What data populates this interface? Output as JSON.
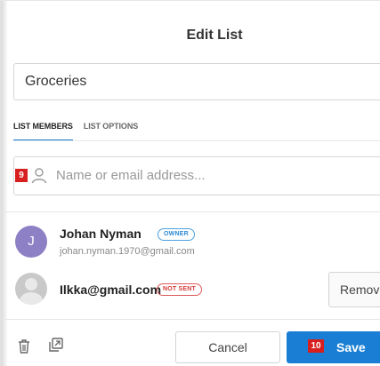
{
  "dialog": {
    "title": "Edit List",
    "list_name_value": "Groceries"
  },
  "tabs": [
    {
      "label": "LIST MEMBERS",
      "active": true
    },
    {
      "label": "LIST OPTIONS",
      "active": false
    }
  ],
  "member_input": {
    "badge": "9",
    "placeholder": "Name or email address..."
  },
  "members": [
    {
      "avatar_letter": "J",
      "name": "Johan Nyman",
      "badge": "OWNER",
      "email": "johan.nyman.1970@gmail.com"
    },
    {
      "avatar_letter": "",
      "name": "Ilkka@gmail.com",
      "badge": "NOT SENT",
      "action": "Remov"
    }
  ],
  "footer": {
    "cancel_label": "Cancel",
    "save_label": "Save",
    "save_badge": "10"
  },
  "colors": {
    "accent": "#1a7fd4",
    "badge_red": "#d81f1f",
    "avatar_purple": "#8e80c4"
  }
}
